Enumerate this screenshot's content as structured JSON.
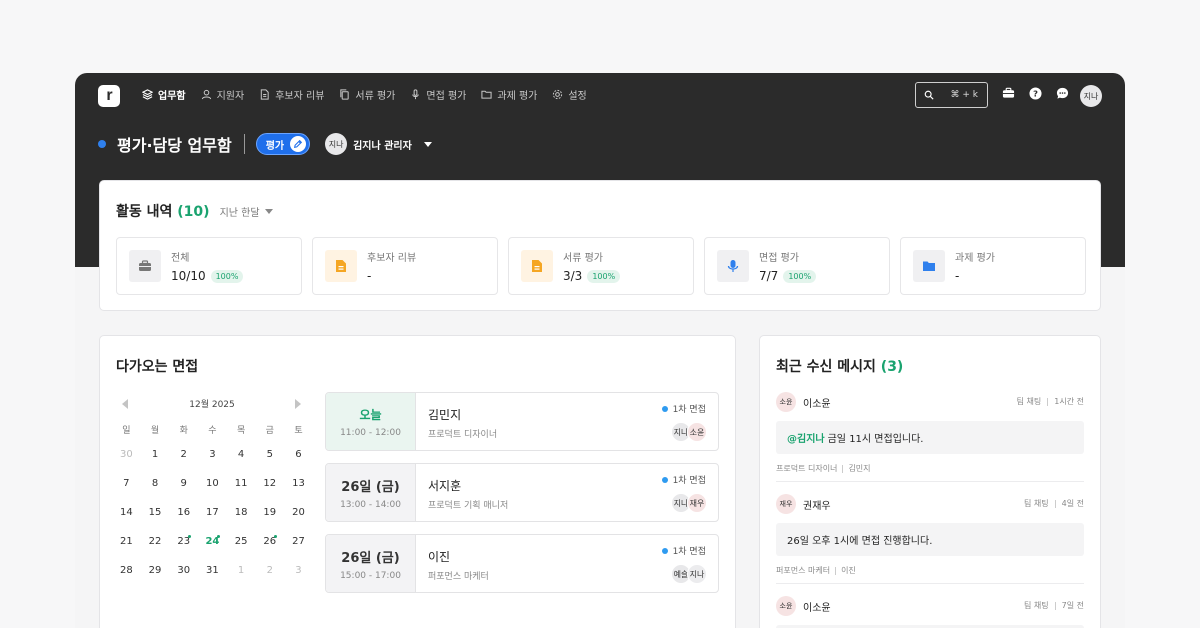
{
  "nav": {
    "items": [
      {
        "label": "업무함",
        "icon": "layers-icon",
        "active": true
      },
      {
        "label": "지원자",
        "icon": "user-icon"
      },
      {
        "label": "후보자 리뷰",
        "icon": "document-icon"
      },
      {
        "label": "서류 평가",
        "icon": "copy-icon"
      },
      {
        "label": "면접 평가",
        "icon": "mic-icon"
      },
      {
        "label": "과제 평가",
        "icon": "folder-icon"
      },
      {
        "label": "설정",
        "icon": "gear-icon"
      }
    ],
    "search_shortcut": "⌘ + k",
    "user_avatar": "지나"
  },
  "header": {
    "title": "평가·담당 업무함",
    "role_label": "평가",
    "user_avatar": "지나",
    "user_name": "김지나 관리자"
  },
  "activity": {
    "title": "활동 내역",
    "count": "(10)",
    "period": "지난 한달",
    "stats": [
      {
        "label": "전체",
        "value": "10/10",
        "badge": "100%",
        "icon": "briefcase-icon",
        "icon_bg": "#f0f0f2",
        "icon_color": "#777777"
      },
      {
        "label": "후보자 리뷰",
        "value": "-",
        "badge": "",
        "icon": "document-icon",
        "icon_bg": "#fff3e2",
        "icon_color": "#f5a623"
      },
      {
        "label": "서류 평가",
        "value": "3/3",
        "badge": "100%",
        "icon": "document-icon",
        "icon_bg": "#fff3e2",
        "icon_color": "#f5a623"
      },
      {
        "label": "면접 평가",
        "value": "7/7",
        "badge": "100%",
        "icon": "mic-icon",
        "icon_bg": "#f0f0f2",
        "icon_color": "#2f80ed"
      },
      {
        "label": "과제 평가",
        "value": "-",
        "badge": "",
        "icon": "folder-icon",
        "icon_bg": "#f0f0f2",
        "icon_color": "#2f80ed"
      }
    ]
  },
  "upcoming": {
    "title": "다가오는 면접",
    "calendar": {
      "month_label": "12월 2025",
      "weekdays": [
        "일",
        "월",
        "화",
        "수",
        "목",
        "금",
        "토"
      ],
      "days": [
        {
          "d": "30",
          "dim": true
        },
        {
          "d": "1"
        },
        {
          "d": "2"
        },
        {
          "d": "3"
        },
        {
          "d": "4"
        },
        {
          "d": "5"
        },
        {
          "d": "6"
        },
        {
          "d": "7"
        },
        {
          "d": "8"
        },
        {
          "d": "9"
        },
        {
          "d": "10"
        },
        {
          "d": "11"
        },
        {
          "d": "12"
        },
        {
          "d": "13"
        },
        {
          "d": "14"
        },
        {
          "d": "15"
        },
        {
          "d": "16"
        },
        {
          "d": "17"
        },
        {
          "d": "18"
        },
        {
          "d": "19"
        },
        {
          "d": "20"
        },
        {
          "d": "21"
        },
        {
          "d": "22"
        },
        {
          "d": "23",
          "dot": true
        },
        {
          "d": "24",
          "dot": true,
          "today": true
        },
        {
          "d": "25"
        },
        {
          "d": "26",
          "dot": true
        },
        {
          "d": "27"
        },
        {
          "d": "28"
        },
        {
          "d": "29"
        },
        {
          "d": "30"
        },
        {
          "d": "31"
        },
        {
          "d": "1",
          "dim": true
        },
        {
          "d": "2",
          "dim": true
        },
        {
          "d": "3",
          "dim": true
        }
      ]
    },
    "interviews": [
      {
        "day": "오늘",
        "today": true,
        "time": "11:00 - 12:00",
        "name": "김민지",
        "role": "프로덕트 디자이너",
        "stage": "1차 면접",
        "avatars": [
          {
            "t": "지나",
            "bg": "#e8e8ea"
          },
          {
            "t": "소윤",
            "bg": "#f6e3e3"
          }
        ]
      },
      {
        "day": "26일 (금)",
        "today": false,
        "time": "13:00 - 14:00",
        "name": "서지훈",
        "role": "프로덕트 기획 매니저",
        "stage": "1차 면접",
        "avatars": [
          {
            "t": "지나",
            "bg": "#e8e8ea"
          },
          {
            "t": "재우",
            "bg": "#f6e3e3"
          }
        ]
      },
      {
        "day": "26일 (금)",
        "today": false,
        "time": "15:00 - 17:00",
        "name": "이진",
        "role": "퍼포먼스 마케터",
        "stage": "1차 면접",
        "avatars": [
          {
            "t": "예슬",
            "bg": "#e8e8ea"
          },
          {
            "t": "지나",
            "bg": "#ececee"
          }
        ]
      }
    ]
  },
  "messages": {
    "title": "최근 수신 메시지",
    "count": "(3)",
    "items": [
      {
        "avatar": "소윤",
        "sender": "이소윤",
        "channel": "팀 채팅",
        "time": "1시간 전",
        "mention": "@김지나",
        "text": "금일 11시 면접입니다.",
        "role": "프로덕트 디자이너",
        "candidate": "김민지"
      },
      {
        "avatar": "재우",
        "sender": "권재우",
        "channel": "팀 채팅",
        "time": "4일 전",
        "mention": "",
        "text": "26일 오후 1시에 면접 진행합니다.",
        "role": "퍼포먼스 마케터",
        "candidate": "이진"
      },
      {
        "avatar": "소윤",
        "sender": "이소윤",
        "channel": "팀 채팅",
        "time": "7일 전",
        "mention": "",
        "text": "",
        "role": "",
        "candidate": ""
      }
    ]
  },
  "colors": {
    "accent_green": "#1aa36f",
    "accent_blue": "#1f6feb",
    "header_dark": "#2b2b2b"
  }
}
